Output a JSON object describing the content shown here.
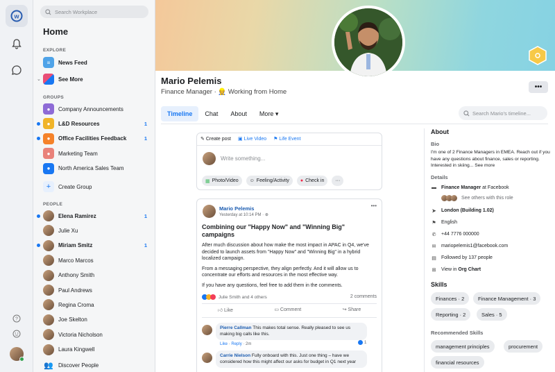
{
  "search": {
    "placeholder": "Search Workplace"
  },
  "sidebar": {
    "title": "Home",
    "explore_label": "EXPLORE",
    "explore": [
      {
        "label": "News Feed"
      },
      {
        "label": "See More"
      }
    ],
    "groups_label": "GROUPS",
    "groups": [
      {
        "label": "Company Announcements",
        "bold": false,
        "count": "",
        "color": "#8e6bd6"
      },
      {
        "label": "L&D Resources",
        "bold": true,
        "count": "1",
        "color": "#f0b429"
      },
      {
        "label": "Office Facilities Feedback",
        "bold": true,
        "count": "1",
        "color": "#f5822a"
      },
      {
        "label": "Marketing Team",
        "bold": false,
        "count": "",
        "color": "#e9827a"
      },
      {
        "label": "North America Sales Team",
        "bold": false,
        "count": "",
        "color": "#1877f2"
      }
    ],
    "create_group": "Create Group",
    "people_label": "PEOPLE",
    "people": [
      {
        "label": "Elena Ramirez",
        "bold": true,
        "count": "1"
      },
      {
        "label": "Julie Xu",
        "bold": false,
        "count": ""
      },
      {
        "label": "Miriam Smitz",
        "bold": true,
        "count": "1"
      },
      {
        "label": "Marco Marcos",
        "bold": false,
        "count": ""
      },
      {
        "label": "Anthony Smith",
        "bold": false,
        "count": ""
      },
      {
        "label": "Paul Andrews",
        "bold": false,
        "count": ""
      },
      {
        "label": "Regina Croma",
        "bold": false,
        "count": ""
      },
      {
        "label": "Joe Skelton",
        "bold": false,
        "count": ""
      },
      {
        "label": "Victoria Nicholson",
        "bold": false,
        "count": ""
      },
      {
        "label": "Laura Kingwell",
        "bold": false,
        "count": ""
      }
    ],
    "discover": "Discover People"
  },
  "profile": {
    "name": "Mario Pelemis",
    "role_prefix": "Finance Manager · ",
    "role_emoji": "👷",
    "role_status": " Working from Home",
    "more_label": "•••"
  },
  "tabs": [
    {
      "label": "Timeline"
    },
    {
      "label": "Chat"
    },
    {
      "label": "About"
    },
    {
      "label": "More ▾"
    }
  ],
  "timeline_search": {
    "placeholder": "Search Mario's timeline..."
  },
  "composer": {
    "actions": [
      {
        "label": "Create post"
      },
      {
        "label": "Live Video"
      },
      {
        "label": "Life Event"
      }
    ],
    "placeholder": "Write something...",
    "buttons": [
      {
        "label": "Photo/Video"
      },
      {
        "label": "Feeling/Activity"
      },
      {
        "label": "Check in"
      },
      {
        "label": "···"
      }
    ]
  },
  "post": {
    "author": "Mario Pelemis",
    "time": "Yesterday at 10:14 PM · ",
    "menu": "•••",
    "title": "Combining our \"Happy Now\" and \"Winning Big\" campaigns",
    "paragraphs": [
      "After much discussion about how make the most impact in APAC in Q4, we've decided to launch assets from \"Happy Now\" and \"Winning Big\" in a hybrid localized campaign.",
      "From a messaging perspective, they align perfectly. And it will allow us to concentrate our efforts and resources in the most effective way.",
      "If you have any questions, feel free to add them in the comments."
    ],
    "reactions": "Julie Smith and 4 others",
    "comments_count": "2 comments",
    "like": "Like",
    "comment": "Comment",
    "share": "Share",
    "comments": [
      {
        "author": "Pierre Callman",
        "text": "This makes total sense. Really pleased to see us making big calls like this.",
        "meta_like": "Like",
        "meta_reply": "Reply",
        "meta_time": "2m",
        "reaction_count": "1"
      },
      {
        "author": "Carrie Nielson",
        "text": "Fully onboard with this. Just one thing – have we considered how this might affect our asks for budget in Q1 next year"
      }
    ]
  },
  "about": {
    "title": "About",
    "bio_label": "Bio",
    "bio": "I'm one of 2 Finance Managers in EMEA. Reach out if you have any questions about finance, sales or reporting. Interested in skiing...",
    "see_more": " See more",
    "details_label": "Details",
    "job_bold": "Finance Manager",
    "job_rest": " at Facebook",
    "others": "See others with this role",
    "location": "London (Building 1.02)",
    "language": "English",
    "phone": "+44 7776 000000",
    "email": "mariopelemis1@facebook.com",
    "followers": "Followed by 137 people",
    "org_prefix": "View in ",
    "org_bold": "Org Chart",
    "skills_label": "Skills",
    "skills": [
      "Finances · 2",
      "Finance Management · 3",
      "Reporting · 2",
      "Sales · 5"
    ],
    "rec_label": "Recommended Skills",
    "rec": [
      "management principles",
      "procurement",
      "financial resources"
    ]
  }
}
